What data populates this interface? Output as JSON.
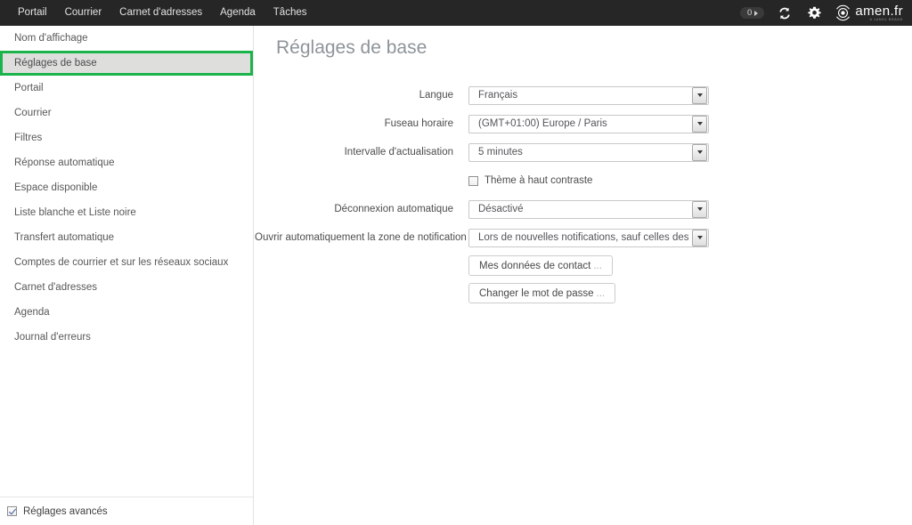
{
  "topbar": {
    "nav": [
      {
        "label": "Portail"
      },
      {
        "label": "Courrier"
      },
      {
        "label": "Carnet d'adresses"
      },
      {
        "label": "Agenda"
      },
      {
        "label": "Tâches"
      }
    ],
    "counter": "0",
    "refresh_icon": "refresh-icon",
    "settings_icon": "gear-icon",
    "brand_name": "amen.fr",
    "brand_sub": "A 1AND1 BRAND"
  },
  "sidebar": {
    "items": [
      {
        "label": "Nom d'affichage",
        "selected": false
      },
      {
        "label": "Réglages de base",
        "selected": true
      },
      {
        "label": "Portail",
        "selected": false
      },
      {
        "label": "Courrier",
        "selected": false
      },
      {
        "label": "Filtres",
        "selected": false
      },
      {
        "label": "Réponse automatique",
        "selected": false
      },
      {
        "label": "Espace disponible",
        "selected": false
      },
      {
        "label": "Liste blanche et Liste noire",
        "selected": false
      },
      {
        "label": "Transfert automatique",
        "selected": false
      },
      {
        "label": "Comptes de courrier et sur les réseaux sociaux",
        "selected": false
      },
      {
        "label": "Carnet d'adresses",
        "selected": false
      },
      {
        "label": "Agenda",
        "selected": false
      },
      {
        "label": "Journal d'erreurs",
        "selected": false
      }
    ],
    "footer": {
      "advanced_label": "Réglages avancés",
      "advanced_checked": true
    },
    "selected_accent": "#1bb44a"
  },
  "main": {
    "title": "Réglages de base",
    "fields": {
      "language": {
        "label": "Langue",
        "value": "Français"
      },
      "timezone": {
        "label": "Fuseau horaire",
        "value": "(GMT+01:00) Europe / Paris"
      },
      "refresh_interval": {
        "label": "Intervalle d'actualisation",
        "value": "5 minutes"
      },
      "high_contrast": {
        "label": "Thème à haut contraste",
        "checked": false
      },
      "auto_logout": {
        "label": "Déconnexion automatique",
        "value": "Désactivé"
      },
      "notification_area": {
        "label": "Ouvrir automatiquement la zone de notification",
        "value": "Lors de nouvelles notifications, sauf celles des courr"
      }
    },
    "buttons": {
      "contact_data": "Mes données de contact",
      "change_password": "Changer le mot de passe",
      "ellipsis": "..."
    }
  }
}
